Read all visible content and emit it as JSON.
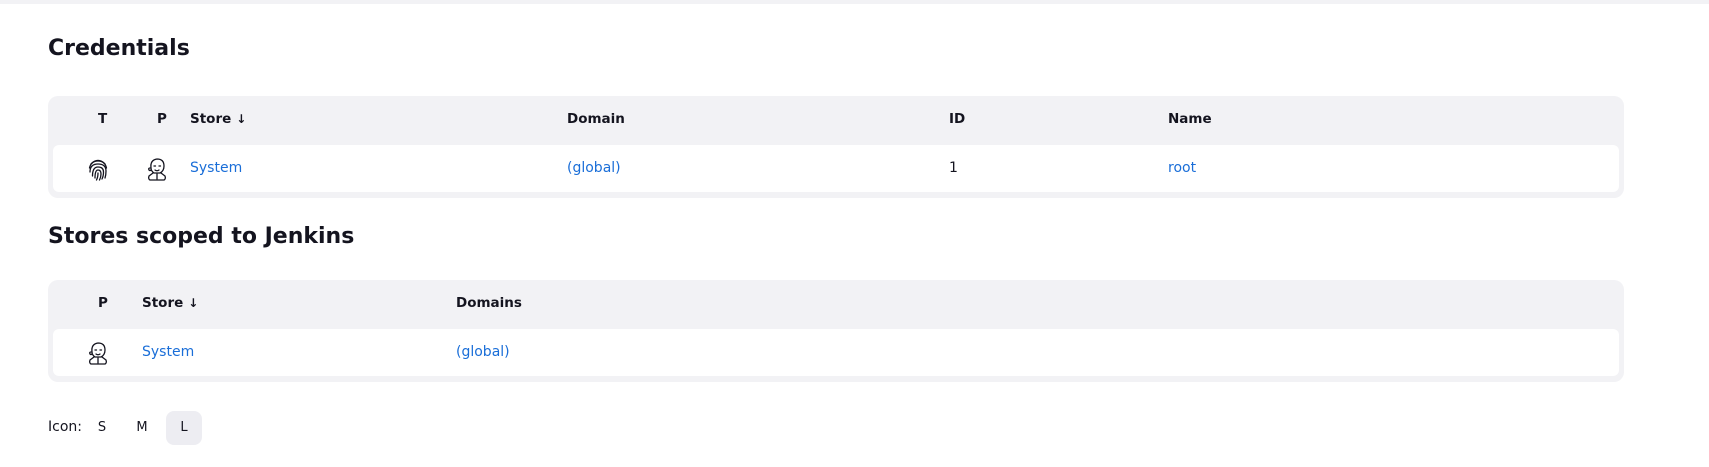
{
  "credentials": {
    "title": "Credentials",
    "headers": {
      "t": "T",
      "p": "P",
      "store": "Store",
      "domain": "Domain",
      "id": "ID",
      "name": "Name"
    },
    "sort_indicator": "↓",
    "rows": [
      {
        "type_icon": "fingerprint-icon",
        "provider_icon": "jenkins-icon",
        "store": "System",
        "domain": "(global)",
        "id": "1",
        "name": "root"
      }
    ]
  },
  "stores": {
    "title": "Stores scoped to Jenkins",
    "headers": {
      "p": "P",
      "store": "Store",
      "domains": "Domains"
    },
    "sort_indicator": "↓",
    "rows": [
      {
        "provider_icon": "jenkins-icon",
        "store": "System",
        "domains": "(global)"
      }
    ]
  },
  "icon_size": {
    "label": "Icon:",
    "options": [
      "S",
      "M",
      "L"
    ],
    "selected": "L"
  },
  "colors": {
    "link": "#1a6ed8",
    "table_bg": "#f2f2f5"
  }
}
